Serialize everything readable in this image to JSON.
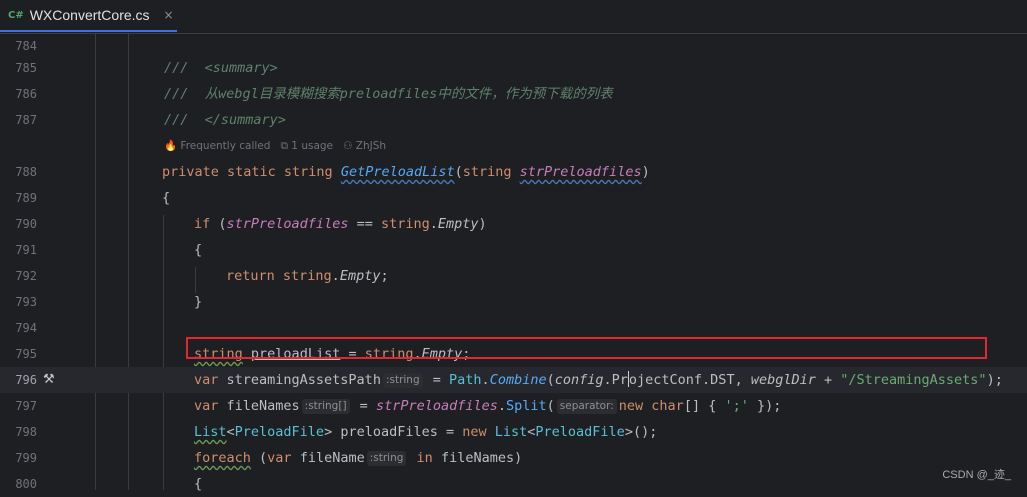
{
  "tab": {
    "icon": "C#",
    "label": "WXConvertCore.cs",
    "close": "×"
  },
  "lens": {
    "frequency": "Frequently called",
    "usages": "1 usage",
    "author": "ZhJSh"
  },
  "lines": [
    {
      "num": "784"
    },
    {
      "num": "785"
    },
    {
      "num": "786"
    },
    {
      "num": "787"
    },
    {
      "num": "788"
    },
    {
      "num": "789"
    },
    {
      "num": "790"
    },
    {
      "num": "791"
    },
    {
      "num": "792"
    },
    {
      "num": "793"
    },
    {
      "num": "794"
    },
    {
      "num": "795"
    },
    {
      "num": "796"
    },
    {
      "num": "797"
    },
    {
      "num": "798"
    },
    {
      "num": "799"
    },
    {
      "num": "800"
    }
  ],
  "code": {
    "l785": "///  <summary>",
    "l786": "///  从webgl目录模糊搜索preloadfiles中的文件，作为预下载的列表",
    "l787": "///  </summary>",
    "hint_string": ":string",
    "hint_string_arr": ":string[]",
    "hint_separator": "separator:",
    "hint_string2": ":string",
    "streaming_assets_literal": "\"/StreamingAssets\"",
    "semicolon_literal": "';'"
  },
  "watermark": "CSDN @_迹_",
  "colors": {
    "background": "#1e1f22",
    "current_line": "#26282e",
    "highlight_box": "#e0282e",
    "tab_underline": "#3574f0"
  }
}
